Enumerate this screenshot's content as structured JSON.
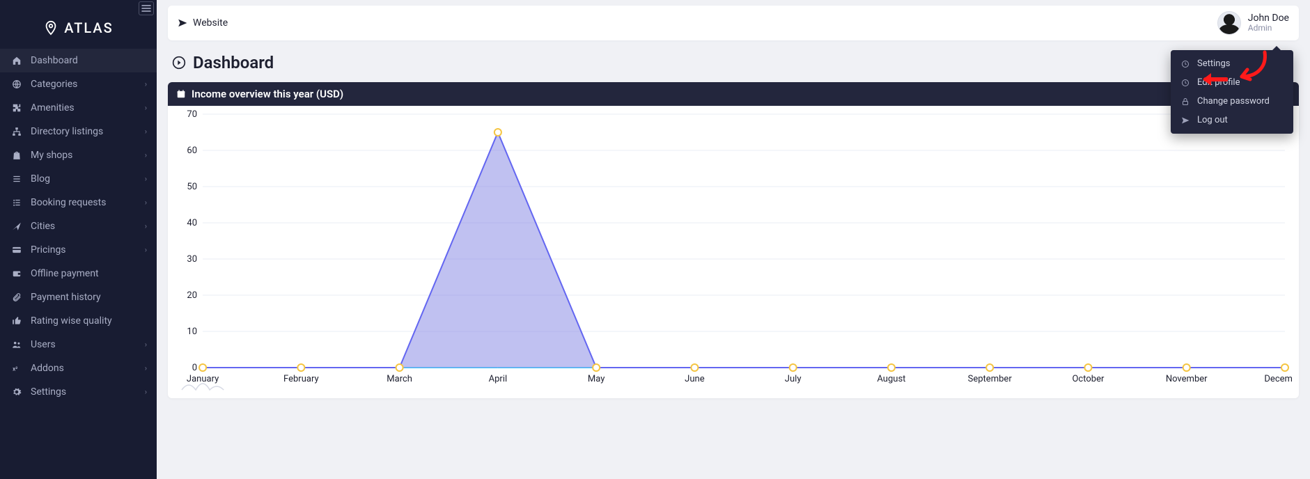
{
  "brand": {
    "name": "ATLAS"
  },
  "sidebar": {
    "items": [
      {
        "label": "Dashboard",
        "icon": "home",
        "expandable": false,
        "active": true
      },
      {
        "label": "Categories",
        "icon": "globe",
        "expandable": true
      },
      {
        "label": "Amenities",
        "icon": "puzzle",
        "expandable": true
      },
      {
        "label": "Directory listings",
        "icon": "sitemap",
        "expandable": true
      },
      {
        "label": "My shops",
        "icon": "bag",
        "expandable": true
      },
      {
        "label": "Blog",
        "icon": "list",
        "expandable": true
      },
      {
        "label": "Booking requests",
        "icon": "tasks",
        "expandable": true
      },
      {
        "label": "Cities",
        "icon": "location",
        "expandable": true
      },
      {
        "label": "Pricings",
        "icon": "card",
        "expandable": true
      },
      {
        "label": "Offline payment",
        "icon": "wallet",
        "expandable": false
      },
      {
        "label": "Payment history",
        "icon": "clip",
        "expandable": false
      },
      {
        "label": "Rating wise quality",
        "icon": "thumb",
        "expandable": false
      },
      {
        "label": "Users",
        "icon": "users",
        "expandable": true
      },
      {
        "label": "Addons",
        "icon": "x2",
        "expandable": true
      },
      {
        "label": "Settings",
        "icon": "gear",
        "expandable": true
      }
    ]
  },
  "topbar": {
    "website_label": "Website",
    "user": {
      "name": "John Doe",
      "role": "Admin"
    }
  },
  "page": {
    "title": "Dashboard"
  },
  "card": {
    "title": "Income overview this year (USD)"
  },
  "profile_menu": {
    "items": [
      {
        "label": "Settings",
        "icon": "clock"
      },
      {
        "label": "Edit profile",
        "icon": "clock"
      },
      {
        "label": "Change password",
        "icon": "lock"
      },
      {
        "label": "Log out",
        "icon": "plane"
      }
    ]
  },
  "chart_data": {
    "type": "area",
    "title": "Income overview this year (USD)",
    "xlabel": "",
    "ylabel": "",
    "ylim": [
      0,
      70
    ],
    "categories": [
      "January",
      "February",
      "March",
      "April",
      "May",
      "June",
      "July",
      "August",
      "September",
      "October",
      "November",
      "December"
    ],
    "values": [
      0,
      0,
      0,
      65,
      0,
      0,
      0,
      0,
      0,
      0,
      0,
      0
    ],
    "y_ticks": [
      0,
      10,
      20,
      30,
      40,
      50,
      60,
      70
    ]
  }
}
